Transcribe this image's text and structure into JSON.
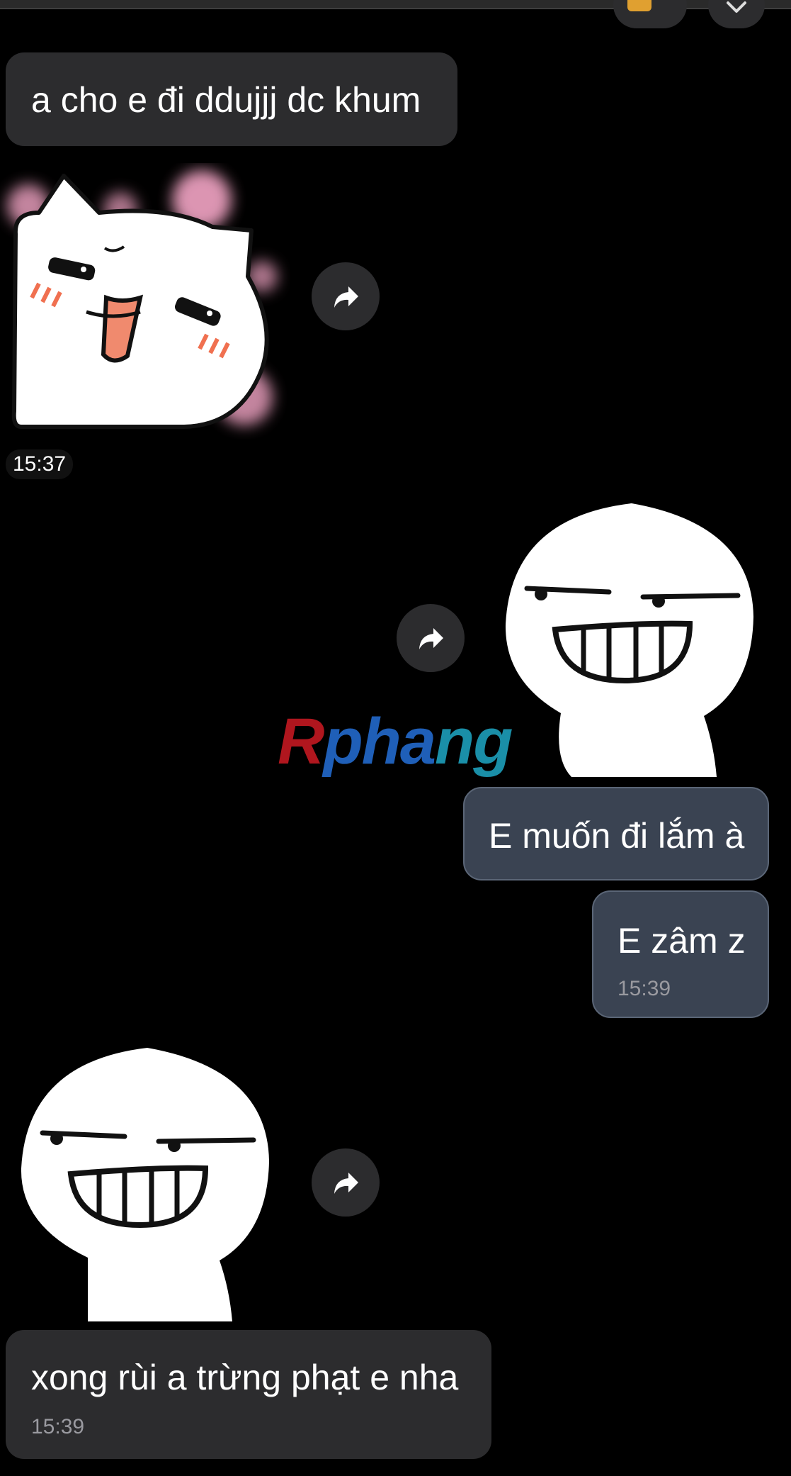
{
  "chat": {
    "messages": [
      {
        "id": "m1",
        "direction": "incoming",
        "type": "text",
        "text": "a cho e đi ddujjj dc khum"
      },
      {
        "id": "m2",
        "direction": "incoming",
        "type": "sticker",
        "sticker": "happy-cat-sticker",
        "time": "15:37"
      },
      {
        "id": "m3",
        "direction": "outgoing",
        "type": "sticker",
        "sticker": "smirk-grin-sticker"
      },
      {
        "id": "m4",
        "direction": "outgoing",
        "type": "text",
        "text": "E muốn đi lắm à"
      },
      {
        "id": "m5",
        "direction": "outgoing",
        "type": "text",
        "text": "E zâm z",
        "time": "15:39"
      },
      {
        "id": "m6",
        "direction": "incoming",
        "type": "sticker",
        "sticker": "smirk-grin-sticker"
      },
      {
        "id": "m7",
        "direction": "incoming",
        "type": "text",
        "text": "xong rùi a trừng phạt e nha",
        "time": "15:39"
      }
    ]
  },
  "watermark": {
    "part1": "R",
    "part2": "pha",
    "part3": "ng"
  },
  "icons": {
    "forward": "share-forward-icon",
    "scroll_down": "chevron-down-icon",
    "reaction": "reaction-emoji-icon"
  },
  "colors": {
    "background": "#000000",
    "incoming_bubble": "#2c2c2e",
    "outgoing_bubble": "#3a4352",
    "time_text": "#9a9aa0"
  }
}
